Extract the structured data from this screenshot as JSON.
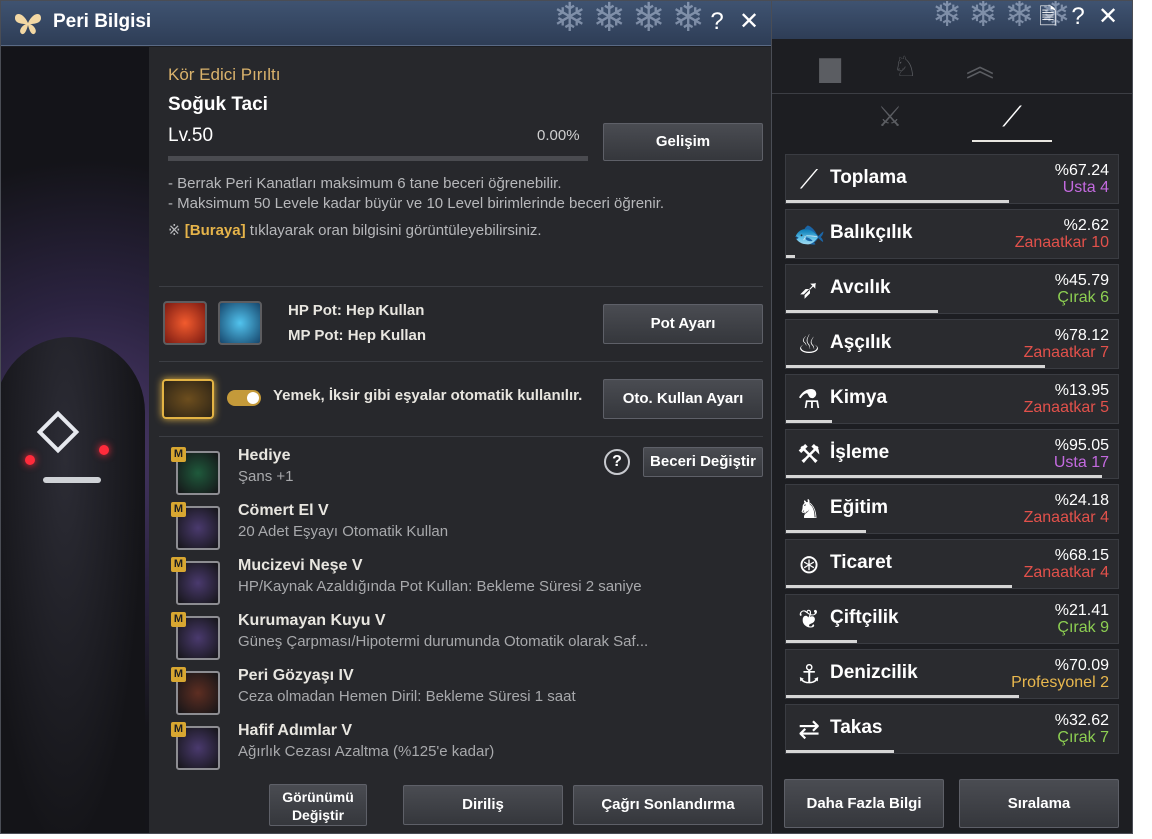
{
  "window": {
    "title": "Peri Bilgisi",
    "help": "?",
    "close": "✕"
  },
  "fairy": {
    "type": "Kör Edici Pırıltı",
    "name": "Soğuk Taci",
    "level": "Lv.50",
    "progress_text": "0.00%",
    "progress": 0.0,
    "grow_button": "Gelişim",
    "info1": "- Berrak Peri Kanatları maksimum 6 tane beceri öğrenebilir.",
    "info2": "- Maksimum 50 Levele kadar büyür ve 10 Level birimlerinde beceri öğrenir.",
    "info3_prefix": "※",
    "info3_link": "[Buraya]",
    "info3_suffix": "tıklayarak oran bilgisini görüntüleyebilirsiniz."
  },
  "potions": {
    "hp": "HP Pot: Hep Kullan",
    "mp": "MP Pot: Hep Kullan",
    "button": "Pot Ayarı"
  },
  "auto_use": {
    "text": "Yemek, İksir gibi eşyalar otomatik kullanılır.",
    "button": "Oto. Kullan Ayarı",
    "enabled": true
  },
  "skills": {
    "change_button": "Beceri Değiştir",
    "help": "?",
    "badge": "M",
    "items": [
      {
        "name": "Hediye",
        "desc": "Şans +1",
        "icon": "clover-icon",
        "color": "#1f5a3c"
      },
      {
        "name": "Cömert El V",
        "desc": "20 Adet Eşyayı Otomatik Kullan",
        "icon": "fairy-icon",
        "color": "#4a3a6e"
      },
      {
        "name": "Mucizevi Neşe V",
        "desc": "HP/Kaynak Azaldığında Pot Kullan: Bekleme Süresi 2 saniye",
        "icon": "potion-icon",
        "color": "#4a3a6e"
      },
      {
        "name": "Kurumayan Kuyu V",
        "desc": "Güneş Çarpması/Hipotermi durumunda Otomatik olarak Saf...",
        "icon": "bowl-icon",
        "color": "#4a3a6e"
      },
      {
        "name": "Peri Gözyaşı IV",
        "desc": "Ceza olmadan Hemen Diril: Bekleme Süresi 1 saat",
        "icon": "tear-icon",
        "color": "#5e2e22"
      },
      {
        "name": "Hafif Adımlar V",
        "desc": "Ağırlık Cezası Azaltma (%125'e kadar)",
        "icon": "weight-icon",
        "color": "#4a3a6e"
      }
    ]
  },
  "bottom": {
    "appearance_line1": "Görünümü",
    "appearance_line2": "Değiştir",
    "revive": "Diriliş",
    "end_summon": "Çağrı Sonlandırma"
  },
  "life": {
    "new": "🗎",
    "help": "?",
    "close": "✕",
    "more_info": "Daha Fazla Bilgi",
    "ranking": "Sıralama",
    "rows": [
      {
        "name": "Toplama",
        "percent": "%67.24",
        "rank": "Usta",
        "level": "4",
        "rank_color": "#c36adf",
        "progress": 0.6724,
        "icon": "sickle-icon",
        "glyph": "⟋"
      },
      {
        "name": "Balıkçılık",
        "percent": "%2.62",
        "rank": "Zanaatkar",
        "level": "10",
        "rank_color": "#e2514b",
        "progress": 0.0262,
        "icon": "fish-icon",
        "glyph": "🐟"
      },
      {
        "name": "Avcılık",
        "percent": "%45.79",
        "rank": "Çırak",
        "level": "6",
        "rank_color": "#8dcf52",
        "progress": 0.4579,
        "icon": "rifle-icon",
        "glyph": "➶"
      },
      {
        "name": "Aşçılık",
        "percent": "%78.12",
        "rank": "Zanaatkar",
        "level": "7",
        "rank_color": "#e2514b",
        "progress": 0.7812,
        "icon": "cooking-icon",
        "glyph": "♨"
      },
      {
        "name": "Kimya",
        "percent": "%13.95",
        "rank": "Zanaatkar",
        "level": "5",
        "rank_color": "#e2514b",
        "progress": 0.1395,
        "icon": "flask-icon",
        "glyph": "⚗"
      },
      {
        "name": "İşleme",
        "percent": "%95.05",
        "rank": "Usta",
        "level": "17",
        "rank_color": "#c36adf",
        "progress": 0.9505,
        "icon": "hammer-icon",
        "glyph": "⚒"
      },
      {
        "name": "Eğitim",
        "percent": "%24.18",
        "rank": "Zanaatkar",
        "level": "4",
        "rank_color": "#e2514b",
        "progress": 0.2418,
        "icon": "horse-icon",
        "glyph": "♞"
      },
      {
        "name": "Ticaret",
        "percent": "%68.15",
        "rank": "Zanaatkar",
        "level": "4",
        "rank_color": "#e2514b",
        "progress": 0.6815,
        "icon": "wheel-icon",
        "glyph": "⊛"
      },
      {
        "name": "Çiftçilik",
        "percent": "%21.41",
        "rank": "Çırak",
        "level": "9",
        "rank_color": "#8dcf52",
        "progress": 0.2141,
        "icon": "sprout-icon",
        "glyph": "❦"
      },
      {
        "name": "Denizcilik",
        "percent": "%70.09",
        "rank": "Profesyonel",
        "level": "2",
        "rank_color": "#e9b84e",
        "progress": 0.7009,
        "icon": "anchor-icon",
        "glyph": "⚓"
      },
      {
        "name": "Takas",
        "percent": "%32.62",
        "rank": "Çırak",
        "level": "7",
        "rank_color": "#8dcf52",
        "progress": 0.3262,
        "icon": "exchange-icon",
        "glyph": "⇄"
      }
    ]
  }
}
